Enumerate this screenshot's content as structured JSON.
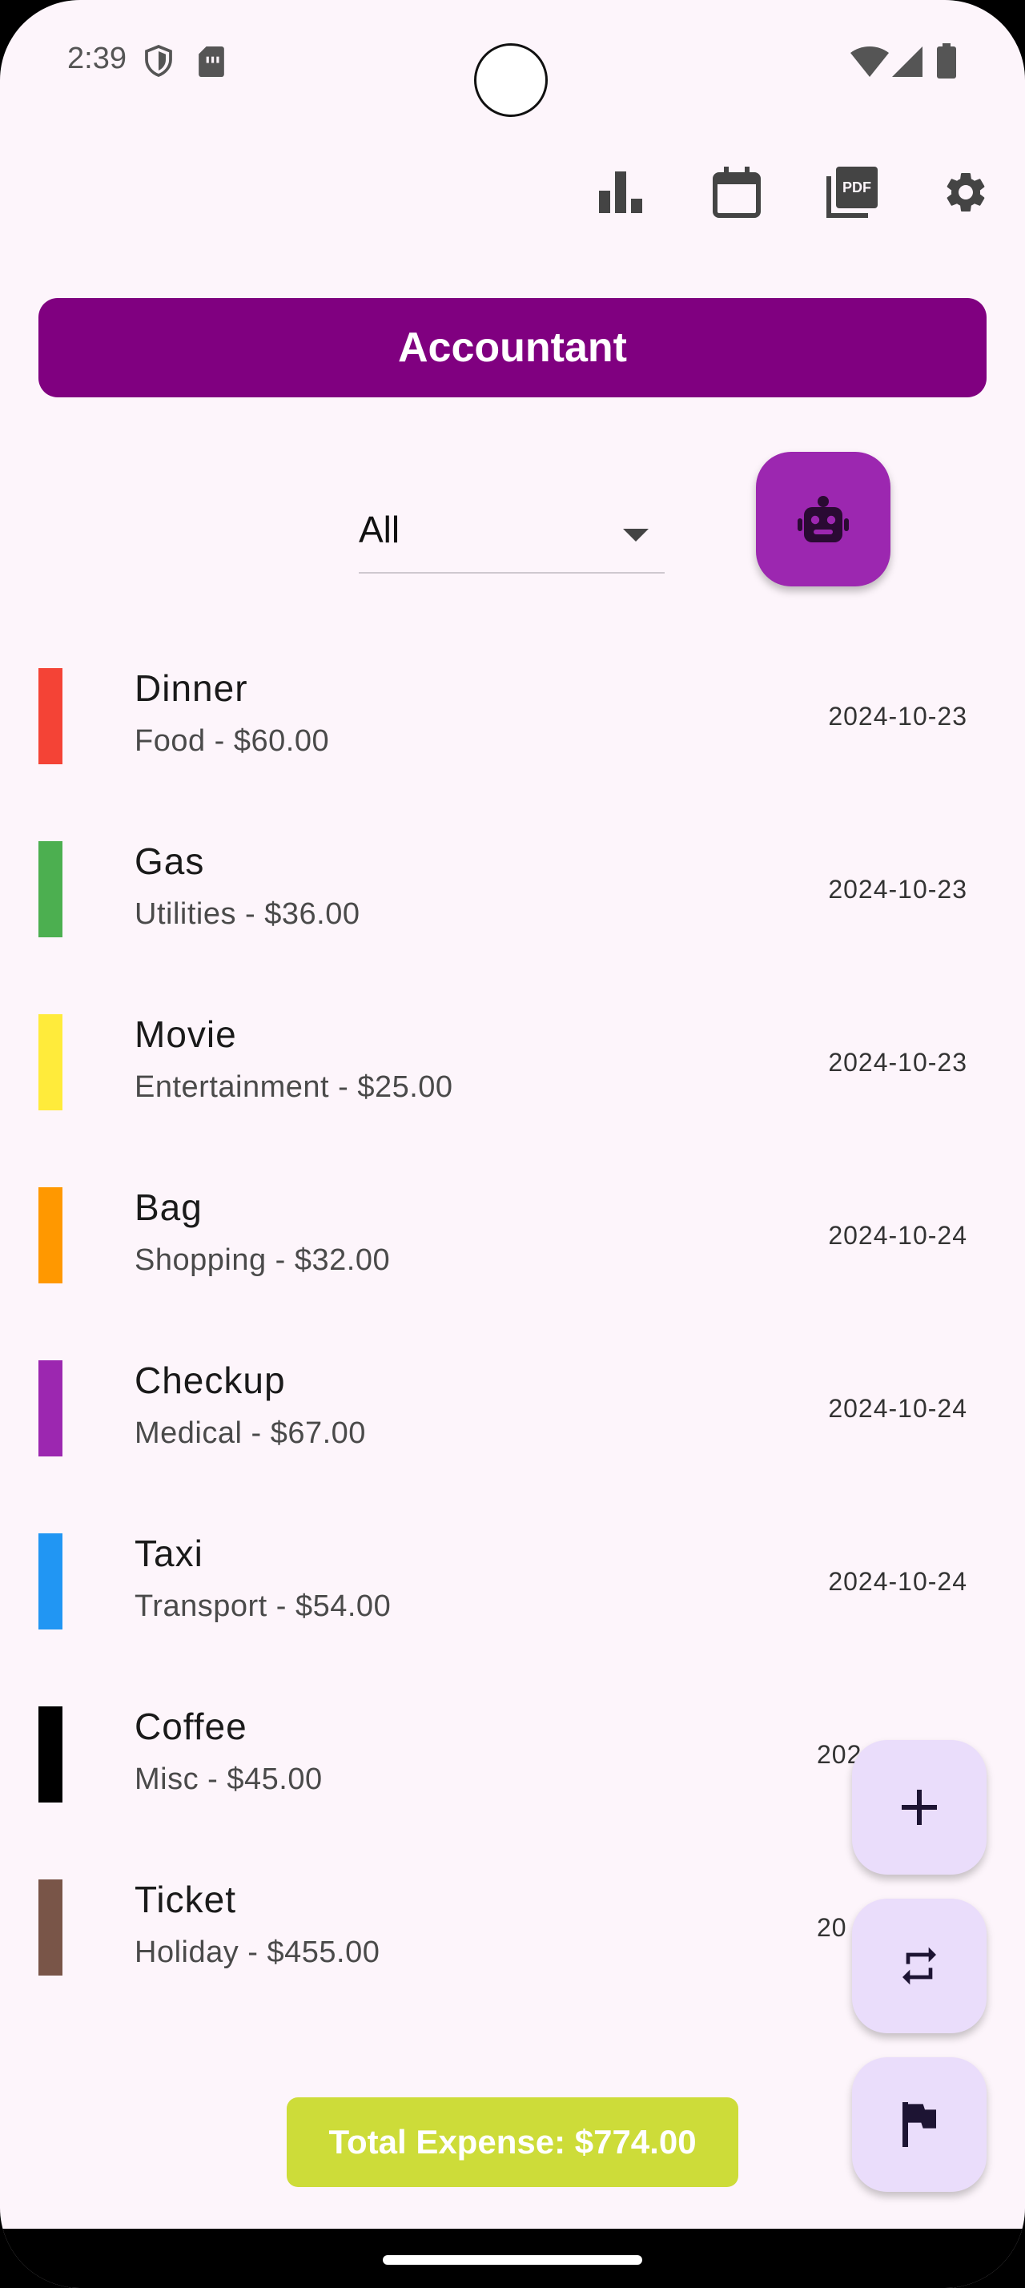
{
  "status_bar": {
    "time": "2:39",
    "icons": [
      "shield-icon",
      "sim-card-icon",
      "wifi-icon",
      "signal-icon",
      "battery-icon"
    ]
  },
  "toolbar": {
    "icons": [
      "bar-chart-icon",
      "calendar-icon",
      "pdf-icon",
      "settings-icon"
    ]
  },
  "app": {
    "title": "Accountant",
    "title_color": "#800080",
    "background": "#fdf5fb"
  },
  "filter": {
    "selected": "All"
  },
  "robot_button": {
    "icon": "robot-icon",
    "color": "#9c27b0"
  },
  "expenses": [
    {
      "name": "Dinner",
      "subtitle": "Food - $60.00",
      "date": "2024-10-23",
      "color": "#f44336"
    },
    {
      "name": "Gas",
      "subtitle": "Utilities - $36.00",
      "date": "2024-10-23",
      "color": "#4caf50"
    },
    {
      "name": "Movie",
      "subtitle": "Entertainment - $25.00",
      "date": "2024-10-23",
      "color": "#ffeb3b"
    },
    {
      "name": "Bag",
      "subtitle": "Shopping - $32.00",
      "date": "2024-10-24",
      "color": "#ff9800"
    },
    {
      "name": "Checkup",
      "subtitle": "Medical - $67.00",
      "date": "2024-10-24",
      "color": "#9c27b0"
    },
    {
      "name": "Taxi",
      "subtitle": "Transport - $54.00",
      "date": "2024-10-24",
      "color": "#2196f3"
    },
    {
      "name": "Coffee",
      "subtitle": "Misc - $45.00",
      "date": "202",
      "color": "#000000"
    },
    {
      "name": "Ticket",
      "subtitle": "Holiday - $455.00",
      "date": "20",
      "color": "#795548"
    }
  ],
  "fabs": [
    {
      "icon": "add-icon",
      "color": "#eaddfb"
    },
    {
      "icon": "repeat-icon",
      "color": "#eaddfb"
    },
    {
      "icon": "flag-icon",
      "color": "#eaddfb"
    }
  ],
  "total": {
    "label": "Total Expense: $774.00",
    "color": "#cddc39"
  }
}
